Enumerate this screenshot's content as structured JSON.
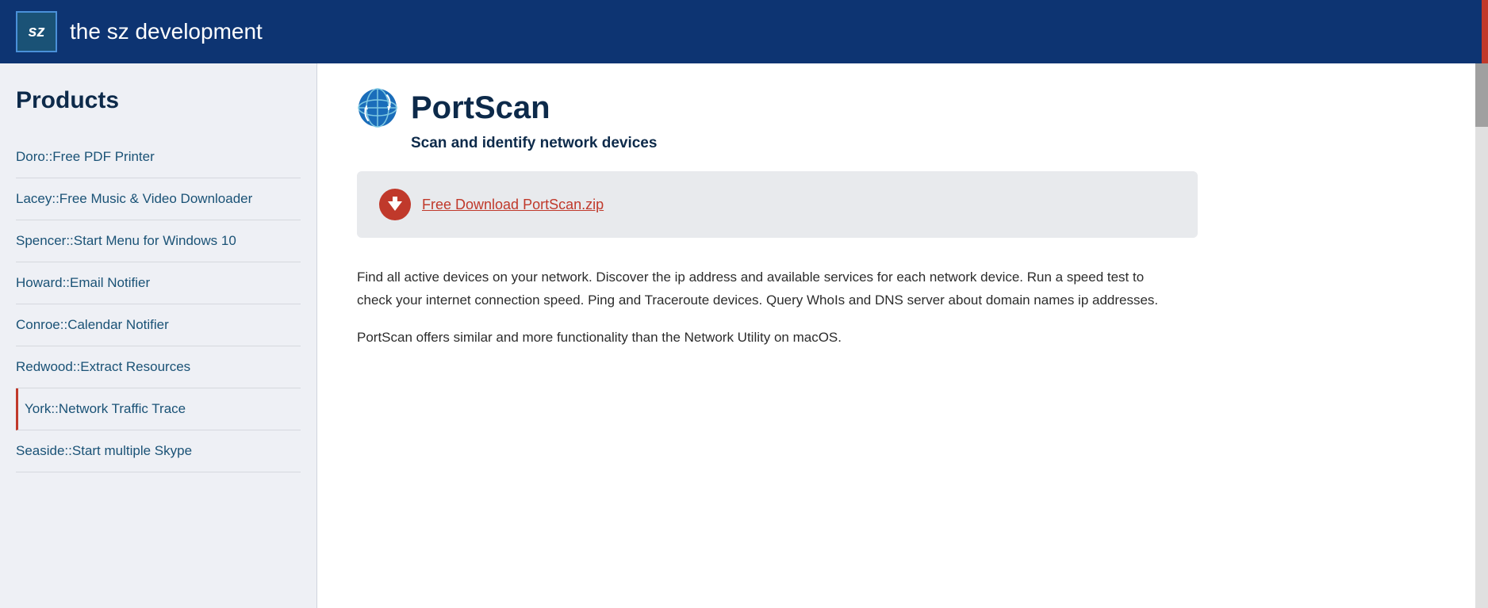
{
  "header": {
    "logo_text": "sz",
    "title": "the sz development"
  },
  "sidebar": {
    "heading": "Products",
    "items": [
      {
        "label": "Doro::Free PDF Printer",
        "active": false
      },
      {
        "label": "Lacey::Free Music & Video Downloader",
        "active": false
      },
      {
        "label": "Spencer::Start Menu for Windows 10",
        "active": false
      },
      {
        "label": "Howard::Email Notifier",
        "active": false
      },
      {
        "label": "Conroe::Calendar Notifier",
        "active": false
      },
      {
        "label": "Redwood::Extract Resources",
        "active": false
      },
      {
        "label": "York::Network Traffic Trace",
        "active": true
      },
      {
        "label": "Seaside::Start multiple Skype",
        "active": false
      }
    ]
  },
  "product": {
    "title": "PortScan",
    "subtitle": "Scan and identify network devices",
    "download_label": "Free Download PortScan.zip",
    "download_href": "#",
    "description_1": "Find all active devices on your network. Discover the ip address and available services for each network device. Run a speed test to check your internet connection speed. Ping and Traceroute devices. Query WhoIs and DNS server about domain names ip addresses.",
    "description_2": "PortScan offers similar and more functionality than the Network Utility on macOS."
  }
}
